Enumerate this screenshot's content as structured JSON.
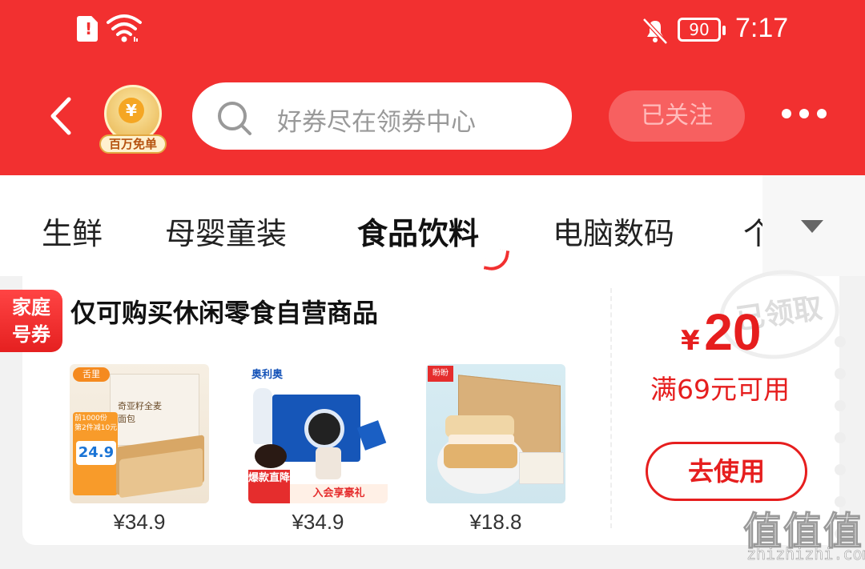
{
  "status": {
    "time": "7:17",
    "battery": "90"
  },
  "header": {
    "avatar_tag": "百万免单",
    "avatar_coin": "¥",
    "search_placeholder": "好券尽在领券中心",
    "follow_label": "已关注"
  },
  "categories": [
    {
      "label": "生鲜",
      "active": false
    },
    {
      "label": "母婴童装",
      "active": false
    },
    {
      "label": "食品饮料",
      "active": true
    },
    {
      "label": "电脑数码",
      "active": false
    },
    {
      "label": "个",
      "active": false
    }
  ],
  "coupon": {
    "badge_line1": "家庭",
    "badge_line2": "号券",
    "title": "仅可购买休闲零食自营商品",
    "stamp_text": "已领取",
    "currency": "¥",
    "amount": "20",
    "condition": "满69元可用",
    "use_label": "去使用",
    "products": [
      {
        "price": "¥34.9",
        "promo_text_1": "前1000份",
        "promo_text_2": "第2件减10元",
        "promo_price": "24.9",
        "brand": "舌里",
        "pack_text": "奇亚籽全麦面包"
      },
      {
        "price": "¥34.9",
        "brand": "奥利奥",
        "tag1": "爆款直降",
        "tag2": "入会享豪礼"
      },
      {
        "price": "¥18.8",
        "brand": "盼盼"
      }
    ]
  },
  "watermark": {
    "big": "值值值",
    "small": "zhizhizhi.com"
  }
}
